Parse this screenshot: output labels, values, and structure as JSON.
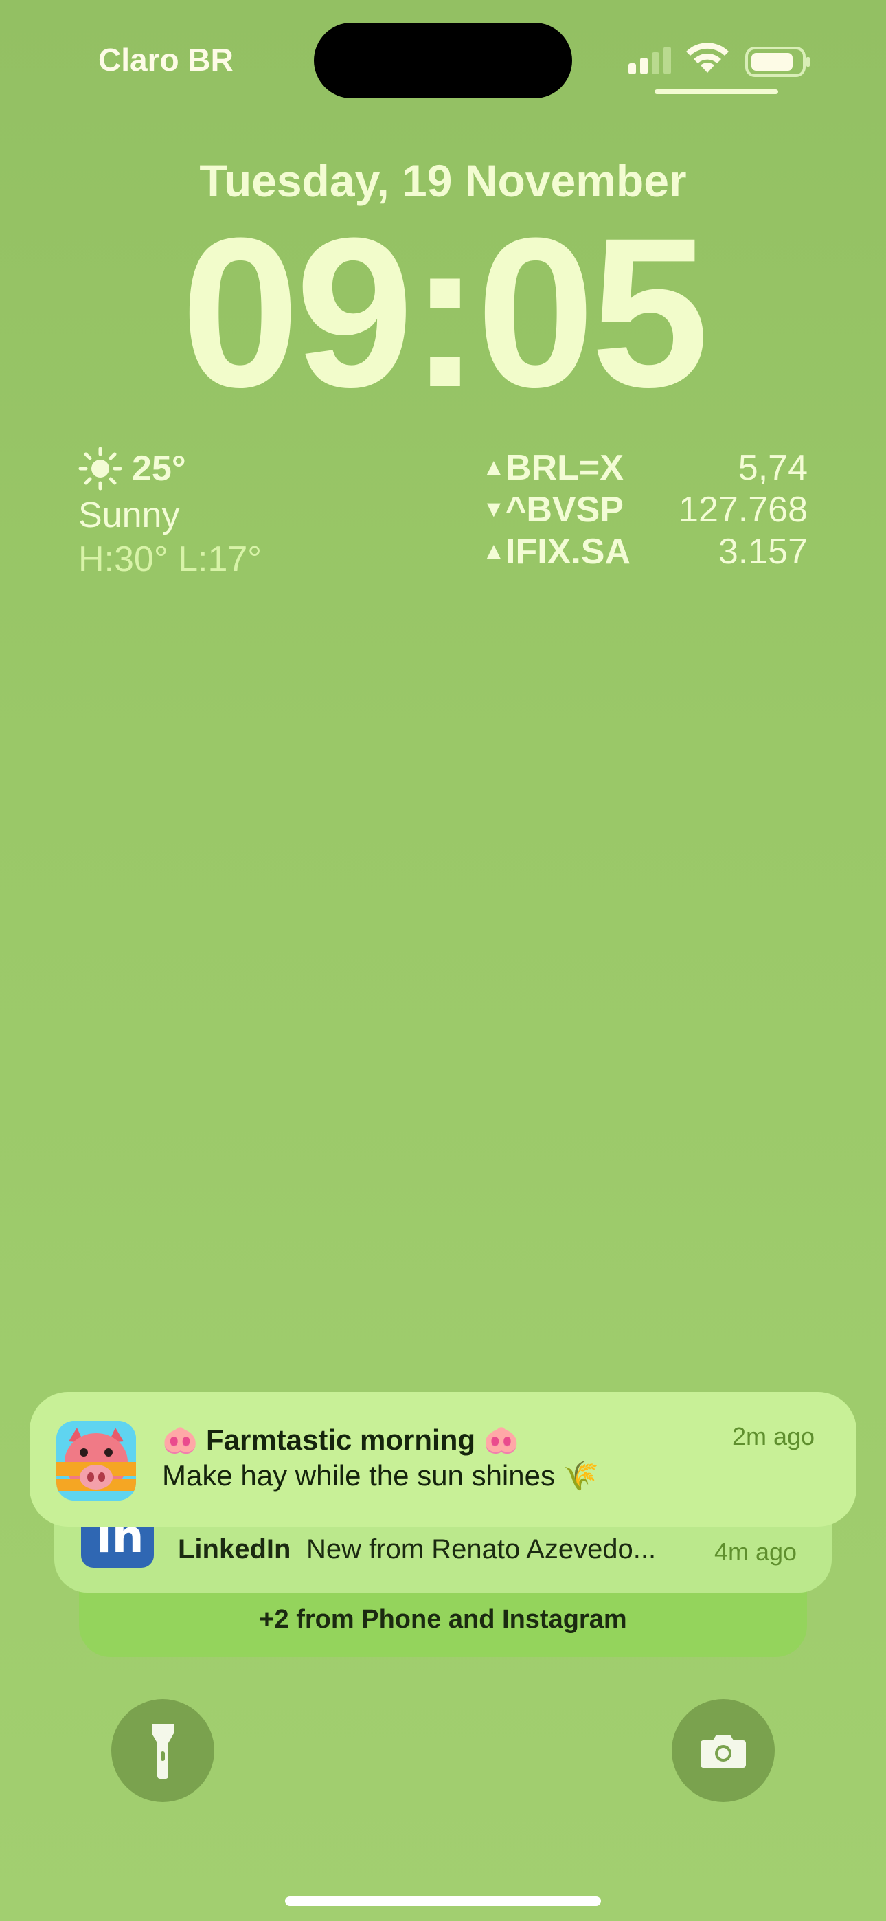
{
  "status_bar": {
    "carrier": "Claro BR",
    "signal_icon": "cellular-signal-icon",
    "wifi_icon": "wifi-icon",
    "battery_icon": "battery-icon"
  },
  "lock_screen": {
    "date": "Tuesday, 19 November",
    "time": "09:05"
  },
  "weather": {
    "icon": "sun-icon",
    "temperature": "25°",
    "condition": "Sunny",
    "high_low": "H:30° L:17°"
  },
  "stocks": [
    {
      "direction": "up",
      "arrow": "▲",
      "symbol": "BRL=X",
      "value": "5,74"
    },
    {
      "direction": "down",
      "arrow": "▼",
      "symbol": "^BVSP",
      "value": "127.768"
    },
    {
      "direction": "up",
      "arrow": "▲",
      "symbol": "IFIX.SA",
      "value": "3.157"
    }
  ],
  "notifications": {
    "main": {
      "app_icon": "farmtastic-pig-app-icon",
      "title": "🐽 Farmtastic morning 🐽",
      "body": "Make hay while the sun shines 🌾",
      "time": "2m ago"
    },
    "second": {
      "app_icon": "linkedin-app-icon",
      "app": "LinkedIn",
      "text": "New from Renato Azevedo...",
      "time": "4m ago"
    },
    "stack_summary": "+2 from Phone and Instagram"
  },
  "controls": {
    "flashlight_icon": "flashlight-icon",
    "camera_icon": "camera-icon"
  },
  "colors": {
    "background": "#9ac868",
    "text": "#f2fccb",
    "notification": "#c8f097",
    "button": "#7aa24e"
  }
}
